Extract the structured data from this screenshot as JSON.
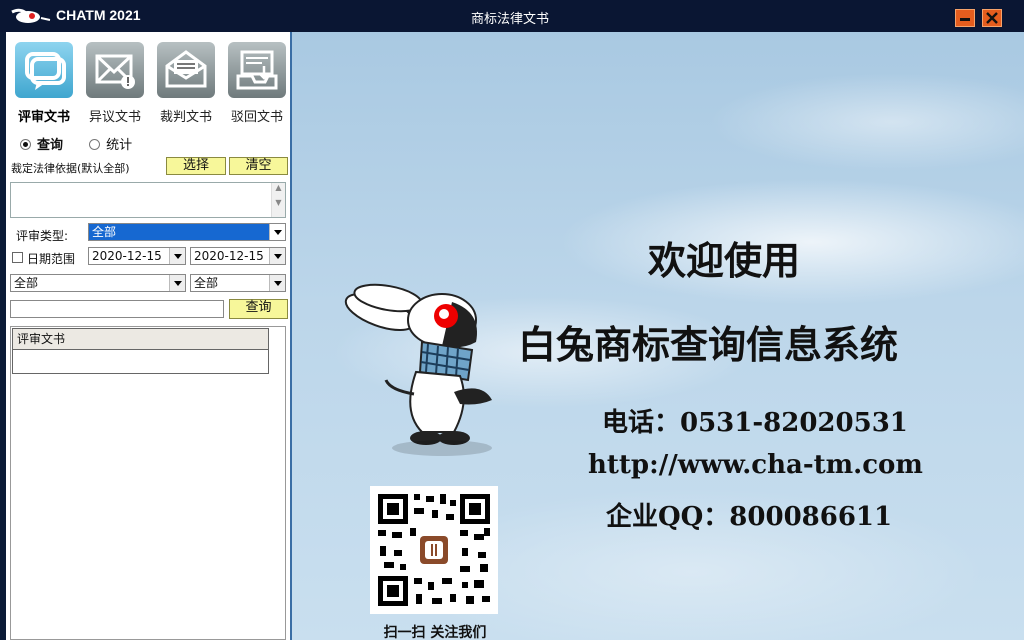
{
  "titlebar": {
    "app_name": "CHATM 2021",
    "window_title": "商标法律文书"
  },
  "tools": [
    {
      "label": "评审文书",
      "icon": "chat-bubble-icon",
      "active": true
    },
    {
      "label": "异议文书",
      "icon": "mail-alert-icon",
      "active": false
    },
    {
      "label": "裁判文书",
      "icon": "open-envelope-icon",
      "active": false
    },
    {
      "label": "驳回文书",
      "icon": "download-tray-icon",
      "active": false
    }
  ],
  "mode": {
    "query_label": "查询",
    "stats_label": "统计",
    "selected": "查询"
  },
  "basis": {
    "label": "裁定法律依据(默认全部)",
    "select_button": "选择",
    "clear_button": "清空",
    "value": ""
  },
  "review_type": {
    "label": "评审类型:",
    "value": "全部"
  },
  "date_range": {
    "label": "日期范围",
    "checked": false,
    "from": "2020-12-15",
    "to": "2020-12-15"
  },
  "filters": {
    "left": "全部",
    "right": "全部"
  },
  "search": {
    "value": "",
    "button": "查询"
  },
  "results": {
    "header": "评审文书"
  },
  "welcome": {
    "line1": "欢迎使用",
    "line2": "白兔商标查询信息系统",
    "phone": "电话：0531-82020531",
    "url": "http://www.cha-tm.com",
    "qq": "企业QQ：800086611"
  },
  "qr_caption": "扫一扫 关注我们",
  "colors": {
    "titlebar": "#0a1633",
    "accent": "#e55d1e",
    "button_yellow": "#f7f79a",
    "selection": "#1668d1"
  }
}
